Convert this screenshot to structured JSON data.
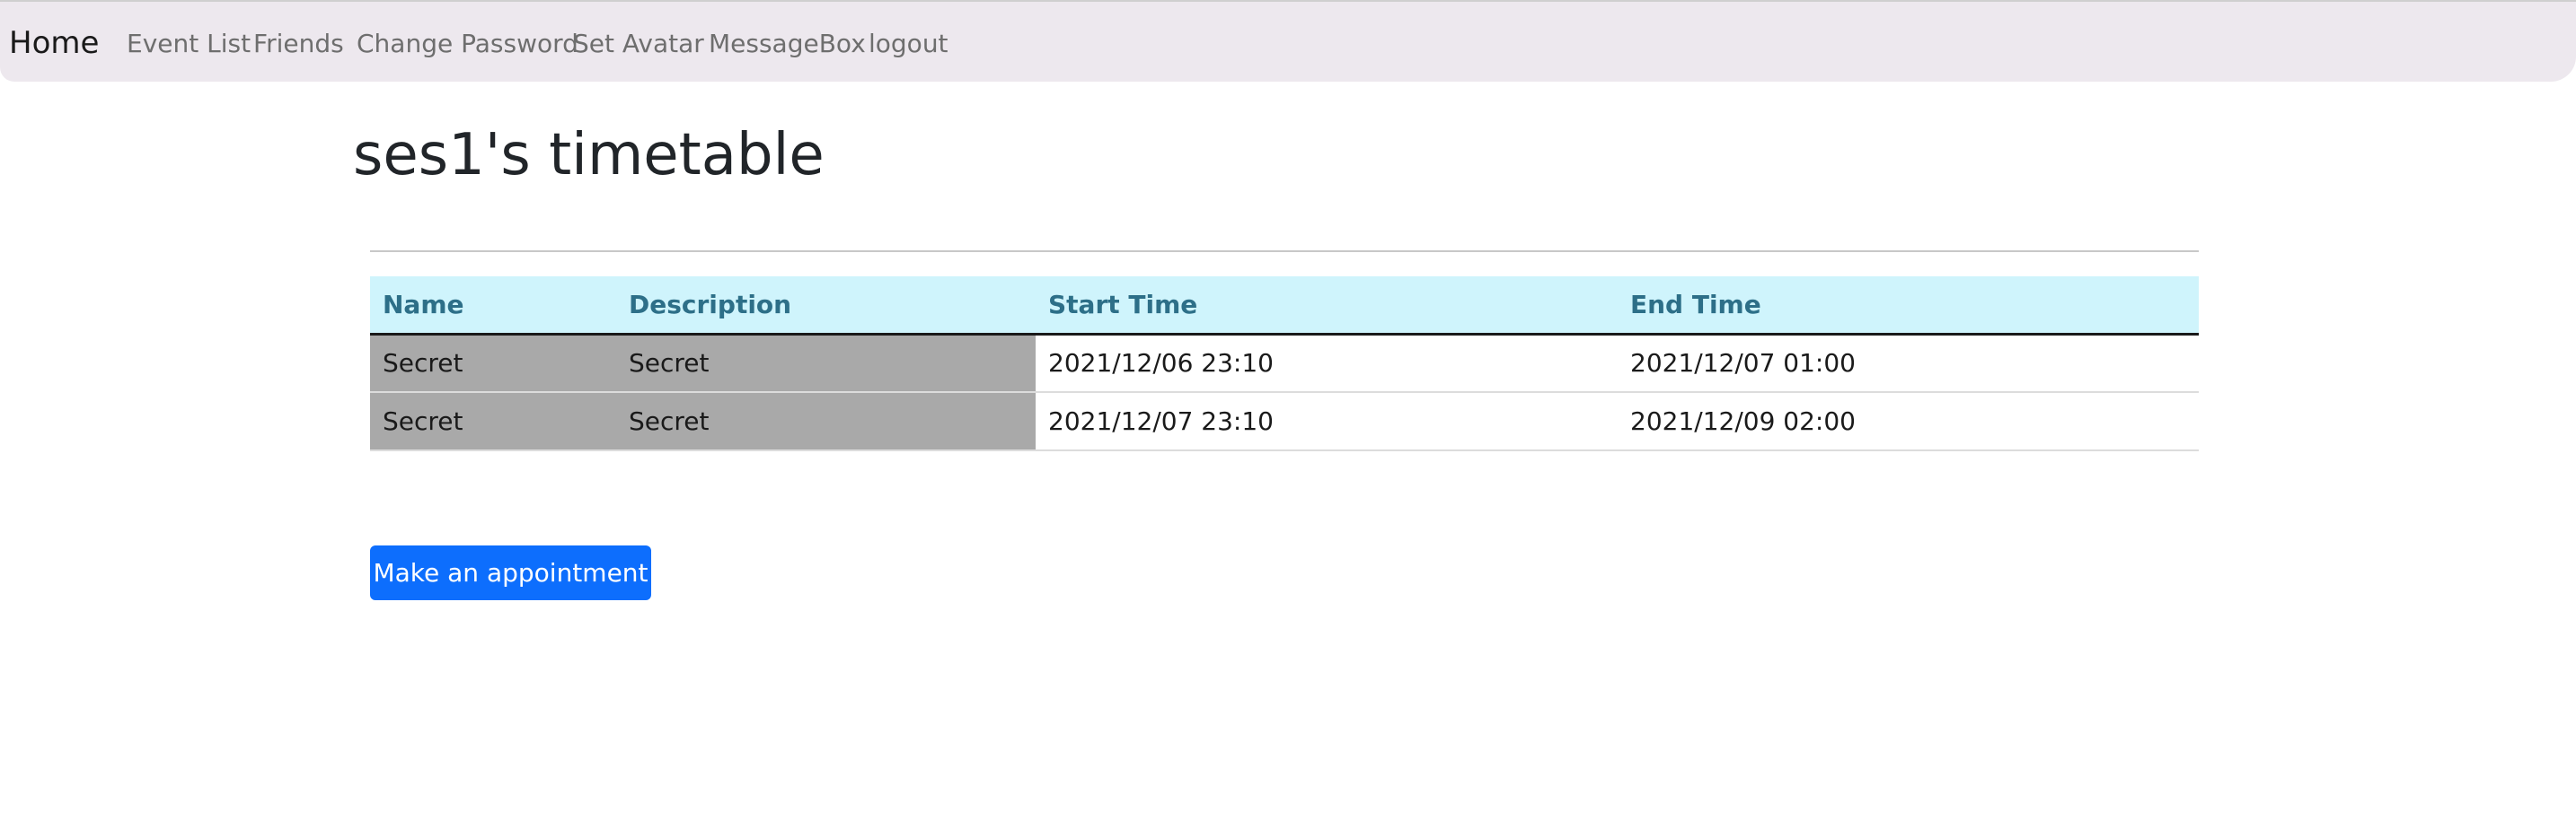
{
  "navbar": {
    "brand": "Home",
    "links": [
      {
        "label": "Event List"
      },
      {
        "label": "Friends"
      },
      {
        "label": "Change Password"
      },
      {
        "label": "Set Avatar"
      },
      {
        "label": "MessageBox"
      },
      {
        "label": "logout"
      }
    ]
  },
  "page": {
    "title": "ses1's timetable"
  },
  "table": {
    "headers": [
      "Name",
      "Description",
      "Start Time",
      "End Time"
    ],
    "rows": [
      {
        "name": "Secret",
        "description": "Secret",
        "start": "2021/12/06 23:10",
        "end": "2021/12/07 01:00"
      },
      {
        "name": "Secret",
        "description": "Secret",
        "start": "2021/12/07 23:10",
        "end": "2021/12/09 02:00"
      }
    ]
  },
  "actions": {
    "appointment_label": "Make an appointment"
  },
  "colors": {
    "navbar_bg": "#ede8ee",
    "header_bg": "#cff4fc",
    "header_text": "#2d6f88",
    "secret_cell_bg": "#a9a9a9",
    "primary_button": "#0d6efd"
  }
}
